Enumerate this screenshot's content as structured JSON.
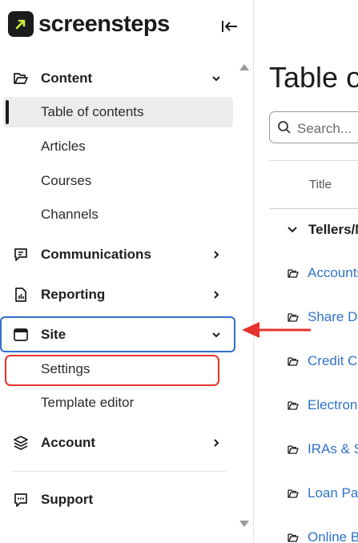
{
  "app": {
    "logo_text": "screensteps",
    "colors": {
      "accent": "#2f6fcc",
      "link": "#2f73c9",
      "highlight": "#e5352b",
      "logo_arrow": "#c8f03c"
    }
  },
  "sidebar": {
    "groups": [
      {
        "label": "Content",
        "icon": "folder-open-icon",
        "expanded": true
      },
      {
        "label": "Communications",
        "icon": "message-icon",
        "expanded": false
      },
      {
        "label": "Reporting",
        "icon": "report-icon",
        "expanded": false
      },
      {
        "label": "Site",
        "icon": "browser-window-icon",
        "expanded": true
      },
      {
        "label": "Account",
        "icon": "layers-icon",
        "expanded": false
      },
      {
        "label": "Support",
        "icon": "chat-icon",
        "expanded": false
      }
    ],
    "content_items": [
      {
        "label": "Table of contents",
        "active": true
      },
      {
        "label": "Articles"
      },
      {
        "label": "Courses"
      },
      {
        "label": "Channels"
      }
    ],
    "site_items": [
      {
        "label": "Settings",
        "highlighted": true
      },
      {
        "label": "Template editor"
      }
    ]
  },
  "main": {
    "title": "Table of contents",
    "search": {
      "placeholder": "Search..."
    },
    "table": {
      "columns": [
        "Title"
      ],
      "group_row": "Tellers/Member Services",
      "rows": [
        "Accounts",
        "Share Drafts",
        "Credit Cards",
        "Electronic Services",
        "IRAs & Savings",
        "Loan Payments",
        "Online Banking"
      ]
    }
  }
}
